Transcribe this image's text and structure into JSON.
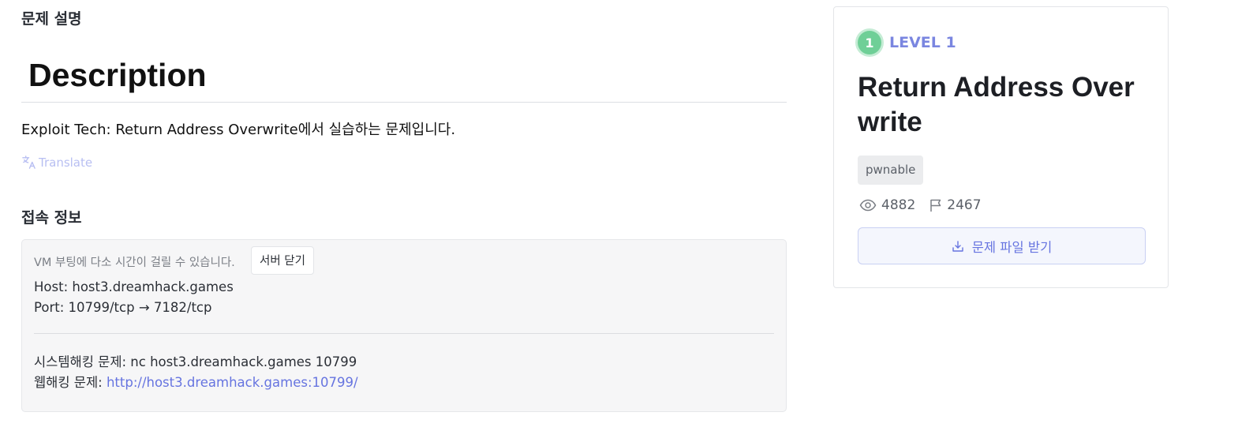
{
  "main": {
    "section_title": "문제 설명",
    "description_heading": "Description",
    "description_text": "Exploit Tech: Return Address Overwrite에서 실습하는 문제입니다.",
    "translate_label": "Translate",
    "connection_title": "접속 정보",
    "connection": {
      "boot_note": "VM 부팅에 다소 시간이 걸릴 수 있습니다.",
      "close_server_label": "서버 닫기",
      "host_line": "Host: host3.dreamhack.games",
      "port_line": "Port:  10799/tcp → 7182/tcp",
      "system_hacking_line": "시스템해킹 문제: nc host3.dreamhack.games 10799",
      "web_hacking_label": "웹해킹 문제: ",
      "web_hacking_url": "http://host3.dreamhack.games:10799/"
    }
  },
  "sidebar": {
    "level_number": "1",
    "level_label": "LEVEL 1",
    "title": "Return Address Overwrite",
    "tag": "pwnable",
    "views": "4882",
    "solves": "2467",
    "download_label": "문제 파일 받기",
    "icons": [
      "eye-icon",
      "flag-icon",
      "download-icon",
      "translate-icon"
    ]
  },
  "colors": {
    "accent": "#6674e0",
    "level_green": "#6fcf97",
    "translate_muted": "#b8bff2"
  }
}
